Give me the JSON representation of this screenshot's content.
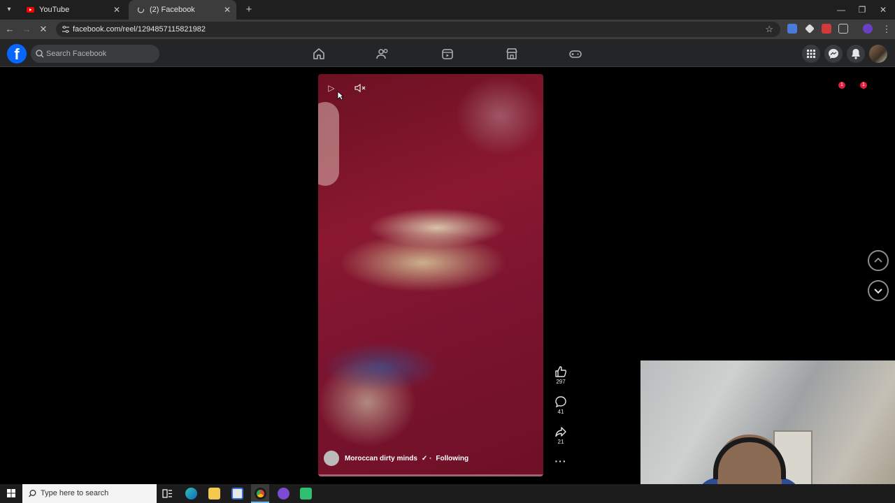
{
  "browser": {
    "tabs": [
      {
        "title": "YouTube",
        "active": false
      },
      {
        "title": "(2) Facebook",
        "active": true
      }
    ],
    "url": "facebook.com/reel/1294857115821982",
    "colors": {
      "youtube": "#ff0000",
      "chrome_bg": "#1f1f1f"
    }
  },
  "facebook": {
    "search_placeholder": "Search Facebook",
    "nav_icons": [
      "home-icon",
      "friends-icon",
      "video-icon",
      "marketplace-icon",
      "gaming-icon"
    ],
    "badges": {
      "messenger": "1",
      "notifications": "1"
    },
    "brand_color": "#0866ff"
  },
  "reel": {
    "author": "Moroccan dirty minds",
    "follow_status": "Following",
    "likes": "297",
    "comments": "41",
    "shares": "21"
  },
  "taskbar": {
    "search_placeholder": "Type here to search"
  }
}
